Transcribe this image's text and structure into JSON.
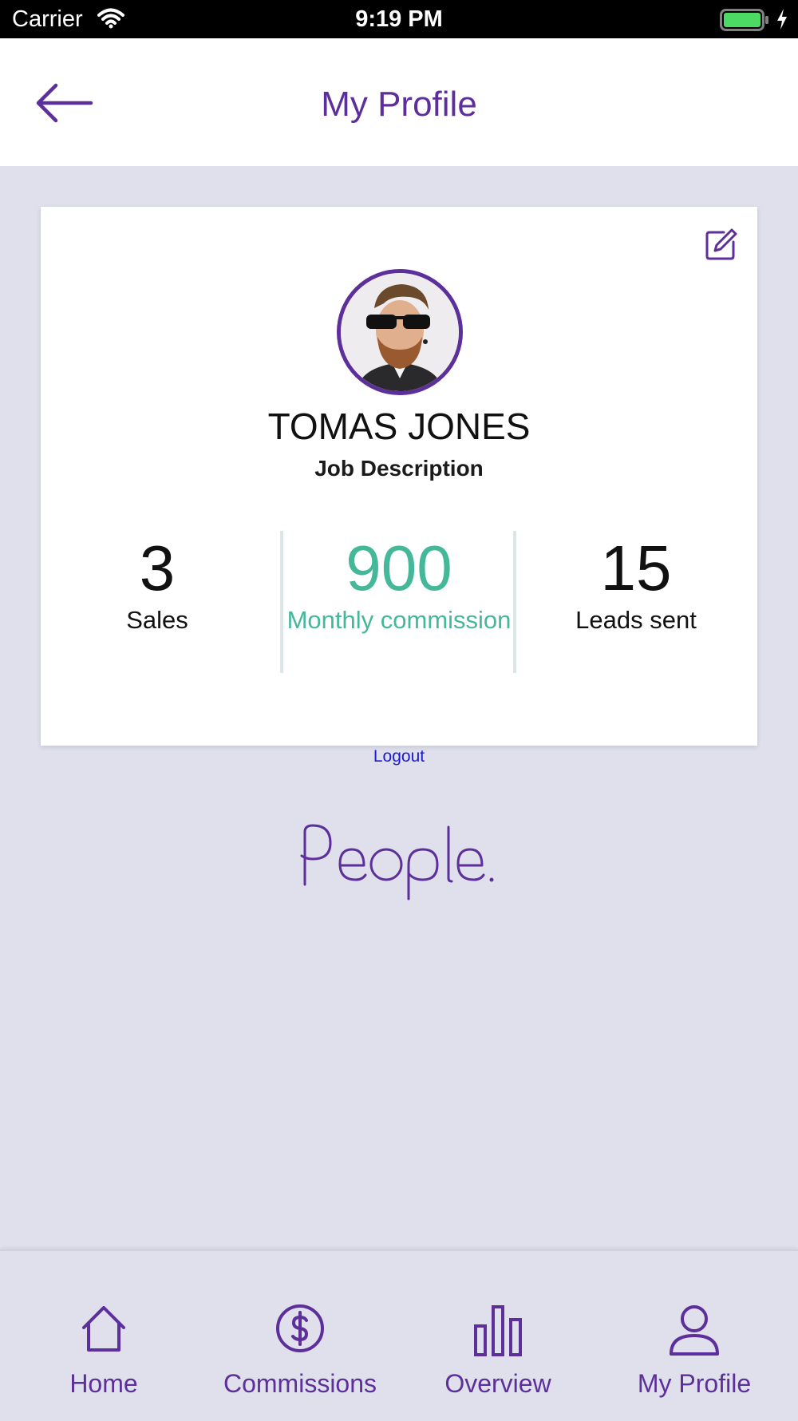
{
  "status_bar": {
    "carrier": "Carrier",
    "time": "9:19 PM"
  },
  "header": {
    "title": "My Profile",
    "back_icon": "arrow-left-icon"
  },
  "profile": {
    "name": "TOMAS JONES",
    "job": "Job Description",
    "edit_icon": "edit-icon",
    "stats": [
      {
        "value": "3",
        "label": "Sales"
      },
      {
        "value": "900",
        "label": "Monthly commission"
      },
      {
        "value": "15",
        "label": "Leads sent"
      }
    ]
  },
  "logout_label": "Logout",
  "logo_text": "People.",
  "tabs": [
    {
      "label": "Home",
      "icon": "home-icon"
    },
    {
      "label": "Commissions",
      "icon": "dollar-circle-icon"
    },
    {
      "label": "Overview",
      "icon": "bar-chart-icon"
    },
    {
      "label": "My Profile",
      "icon": "user-icon"
    }
  ],
  "colors": {
    "brand": "#5d2f9b",
    "accent": "#45b89a",
    "background": "#dfe0ec",
    "link": "#1a1ad0"
  }
}
